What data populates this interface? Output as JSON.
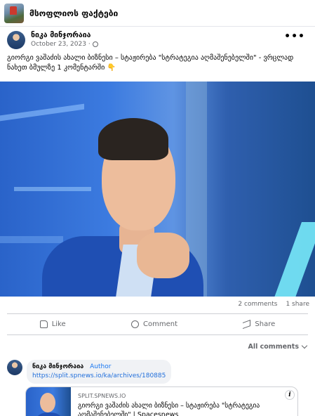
{
  "group": {
    "name": "მსოფლიოს ფაქტები"
  },
  "post": {
    "author": "ნიკა მინჯორაია",
    "date": "October 23, 2023 · ",
    "text": "გიორგი ვაშაძის ახალი ბიზნესი – სტაჟირება \"სტრატეგია აღმაშენებელში\" - ვრცლად ნახეთ ბმულზე 1 კომენტარში 👇",
    "more_label": "•••",
    "stats": {
      "comments": "2 comments",
      "shares": "1 share"
    },
    "actions": {
      "like": "Like",
      "comment": "Comment",
      "share": "Share"
    }
  },
  "comments": {
    "filter_label": "All comments",
    "items": [
      {
        "author": "ნიკა მინჯორაია",
        "badge": "Author",
        "link": "https://split.spnews.io/ka/archives/180885"
      }
    ]
  },
  "link_card": {
    "domain": "SPLIT.SPNEWS.IO",
    "title": "გიორგი ვაშაძის ახალი ბიზნესი – სტაჟირება \"სტრატეგია აღმაშენებელში\" | Spacesnews",
    "info_label": "i"
  }
}
